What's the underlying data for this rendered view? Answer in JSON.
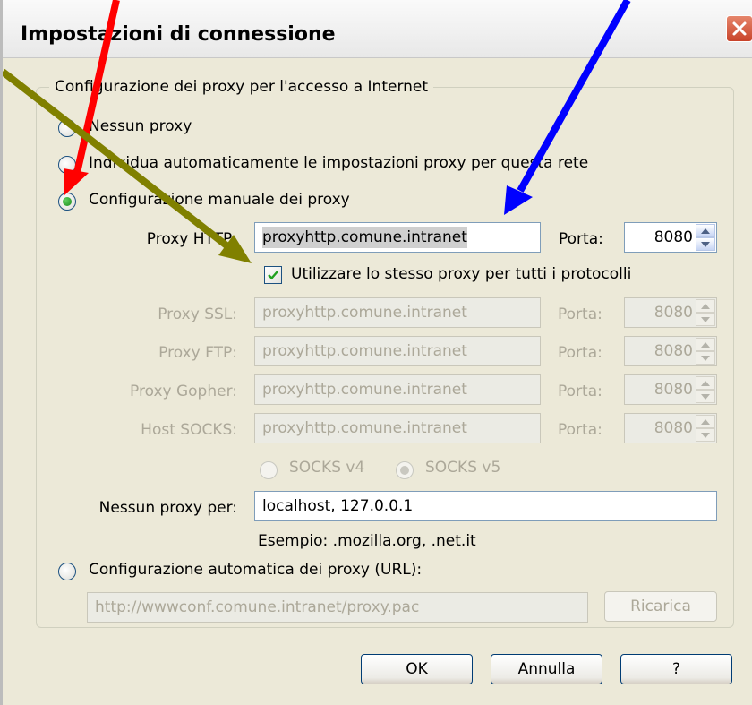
{
  "window": {
    "title": "Impostazioni di connessione"
  },
  "group": {
    "legend": "Configurazione dei proxy per l'accesso a Internet"
  },
  "radios": {
    "no_proxy": "Nessun proxy",
    "auto_detect": "Individua automaticamente le impostazioni proxy per questa rete",
    "manual": "Configurazione manuale dei proxy",
    "auto_config": "Configurazione automatica dei proxy (URL):",
    "selected": "manual"
  },
  "manual": {
    "http_label": "Proxy HTTP:",
    "http_value": "proxyhttp.comune.intranet",
    "http_port_label": "Porta:",
    "http_port": "8080",
    "same_proxy_label": "Utilizzare lo stesso proxy per tutti i protocolli",
    "same_proxy_checked": true,
    "ssl_label": "Proxy SSL:",
    "ssl_value": "proxyhttp.comune.intranet",
    "ssl_port_label": "Porta:",
    "ssl_port": "8080",
    "ftp_label": "Proxy FTP:",
    "ftp_value": "proxyhttp.comune.intranet",
    "ftp_port_label": "Porta:",
    "ftp_port": "8080",
    "gopher_label": "Proxy Gopher:",
    "gopher_value": "proxyhttp.comune.intranet",
    "gopher_port_label": "Porta:",
    "gopher_port": "8080",
    "socks_label": "Host SOCKS:",
    "socks_value": "proxyhttp.comune.intranet",
    "socks_port_label": "Porta:",
    "socks_port": "8080",
    "socks_v4": "SOCKS v4",
    "socks_v5": "SOCKS v5",
    "no_proxy_for_label": "Nessun proxy per:",
    "no_proxy_for_value": "localhost, 127.0.0.1",
    "example": "Esempio: .mozilla.org, .net.it"
  },
  "auto": {
    "url_value": "http://wwwconf.comune.intranet/proxy.pac",
    "reload_label": "Ricarica"
  },
  "buttons": {
    "ok": "OK",
    "cancel": "Annulla",
    "help": "?"
  },
  "colors": {
    "arrow_red": "#ff0000",
    "arrow_blue": "#0000ff",
    "arrow_olive": "#808000",
    "close_red": "#c8432a"
  }
}
